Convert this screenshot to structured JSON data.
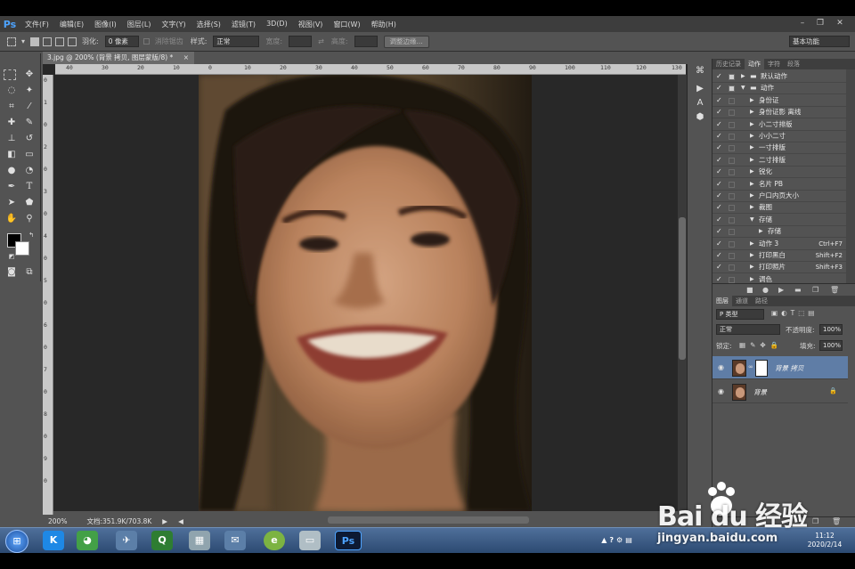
{
  "app": {
    "logo": "Ps",
    "menu": [
      "文件(F)",
      "编辑(E)",
      "图像(I)",
      "图层(L)",
      "文字(Y)",
      "选择(S)",
      "滤镜(T)",
      "3D(D)",
      "视图(V)",
      "窗口(W)",
      "帮助(H)"
    ],
    "window_controls": {
      "minimize": "–",
      "restore": "❐",
      "close": "✕"
    }
  },
  "options": {
    "feather_label": "羽化:",
    "feather_value": "0 像素",
    "antialias_label": "消除锯齿",
    "style_label": "样式:",
    "style_value": "正常",
    "width_label": "宽度:",
    "height_label": "高度:",
    "refine_edge": "调整边缘...",
    "workspace": "基本功能"
  },
  "document": {
    "tab_title": "3.jpg @ 200% (背景 拷贝, 图层蒙版/8) *",
    "close": "×",
    "zoom": "200%",
    "doc_size": "文档:351.9K/703.8K",
    "ruler_top": [
      "40",
      "30",
      "20",
      "10",
      "0",
      "10",
      "20",
      "30",
      "40",
      "50",
      "60",
      "70",
      "80",
      "90",
      "100",
      "110",
      "120",
      "130"
    ],
    "ruler_left": [
      "0",
      "1",
      "0",
      "2",
      "0",
      "3",
      "0",
      "4",
      "0",
      "5",
      "0",
      "6",
      "0",
      "7",
      "0",
      "8",
      "0",
      "9",
      "0"
    ]
  },
  "actions_panel": {
    "tabs": [
      "历史记录",
      "动作",
      "字符",
      "段落"
    ],
    "active_tab": "动作",
    "rows": [
      {
        "label": "默认动作",
        "indent": 0,
        "folder": true,
        "open": false,
        "short": ""
      },
      {
        "label": "动作",
        "indent": 0,
        "folder": true,
        "open": true,
        "short": ""
      },
      {
        "label": "身份证",
        "indent": 1,
        "folder": false,
        "open": false,
        "short": ""
      },
      {
        "label": "身份证影 离线",
        "indent": 1,
        "folder": false,
        "open": false,
        "short": ""
      },
      {
        "label": "小二寸排版",
        "indent": 1,
        "folder": false,
        "open": false,
        "short": ""
      },
      {
        "label": "小小二寸",
        "indent": 1,
        "folder": false,
        "open": false,
        "short": ""
      },
      {
        "label": "一寸排版",
        "indent": 1,
        "folder": false,
        "open": false,
        "short": ""
      },
      {
        "label": "二寸排版",
        "indent": 1,
        "folder": false,
        "open": false,
        "short": ""
      },
      {
        "label": "锐化",
        "indent": 1,
        "folder": false,
        "open": false,
        "short": ""
      },
      {
        "label": "名片 PB",
        "indent": 1,
        "folder": false,
        "open": false,
        "short": ""
      },
      {
        "label": "户口内页大小",
        "indent": 1,
        "folder": false,
        "open": false,
        "short": ""
      },
      {
        "label": "裁图",
        "indent": 1,
        "folder": false,
        "open": false,
        "short": ""
      },
      {
        "label": "存储",
        "indent": 1,
        "folder": false,
        "open": true,
        "short": ""
      },
      {
        "label": "存储",
        "indent": 2,
        "folder": false,
        "open": false,
        "short": ""
      },
      {
        "label": "动作 3",
        "indent": 1,
        "folder": false,
        "open": false,
        "short": "Ctrl+F7"
      },
      {
        "label": "打印黑白",
        "indent": 1,
        "folder": false,
        "open": false,
        "short": "Shift+F2"
      },
      {
        "label": "打印照片",
        "indent": 1,
        "folder": false,
        "open": false,
        "short": "Shift+F3"
      },
      {
        "label": "调色",
        "indent": 1,
        "folder": false,
        "open": false,
        "short": ""
      }
    ]
  },
  "layers_panel": {
    "tabs": [
      "图层",
      "通道",
      "路径"
    ],
    "active_tab": "图层",
    "filter": "P 类型",
    "blend_mode": "正常",
    "opacity_label": "不透明度:",
    "opacity": "100%",
    "lock_label": "锁定:",
    "fill_label": "填充:",
    "fill": "100%",
    "layers": [
      {
        "name": "背景 拷贝",
        "selected": true,
        "mask": true,
        "locked": false
      },
      {
        "name": "背景",
        "selected": false,
        "mask": false,
        "locked": true
      }
    ]
  },
  "taskbar": {
    "start": "⊞",
    "time": "11:12",
    "date": "2020/2/14"
  },
  "watermark": {
    "logo": "Bai du 经验",
    "url": "jingyan.baidu.com"
  },
  "colors": {
    "ui_bg": "#535353",
    "canvas_bg": "#282828",
    "selected_layer": "#5f7da6",
    "ps_blue": "#4da3ff"
  }
}
